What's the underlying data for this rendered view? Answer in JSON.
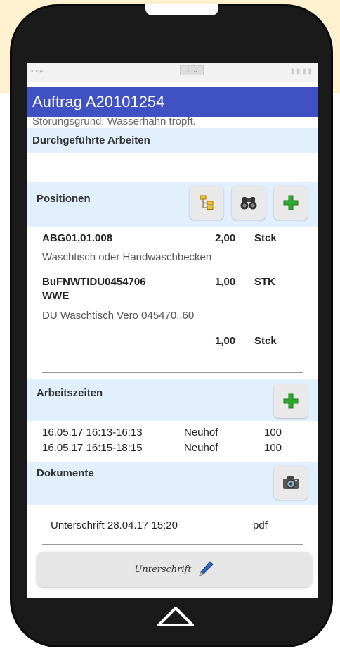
{
  "app": {
    "title": "Auftrag A20101254"
  },
  "reason_text": "Störungsgrund: Wasserhahn tropft.",
  "sections": {
    "done_work": {
      "title": "Durchgeführte Arbeiten"
    },
    "positions": {
      "title": "Positionen"
    },
    "work_times": {
      "title": "Arbeitszeiten"
    },
    "documents": {
      "title": "Dokumente"
    }
  },
  "positions": [
    {
      "code": "ABG01.01.008",
      "qty": "2,00",
      "unit": "Stck",
      "desc": "Waschtisch oder Handwaschbecken"
    },
    {
      "code": "BuFNWTIDU0454706",
      "code2": "WWE",
      "qty": "1,00",
      "unit": "STK",
      "desc": "DU Waschtisch Vero 045470..60"
    },
    {
      "code": "",
      "qty": "1,00",
      "unit": "Stck",
      "desc": ""
    }
  ],
  "work_times": [
    {
      "time": "16.05.17 16:13-16:13",
      "who": "Neuhof",
      "value": "100"
    },
    {
      "time": "16.05.17 16:15-18:15",
      "who": "Neuhof",
      "value": "100"
    }
  ],
  "documents": [
    {
      "name": "Unterschrift 28.04.17 15:20",
      "type": "pdf"
    }
  ],
  "signature_button": {
    "label": "Unterschrift"
  },
  "colors": {
    "appbar": "#3f51c3",
    "section_bg": "#e2effd",
    "add_green": "#2fa82f"
  }
}
